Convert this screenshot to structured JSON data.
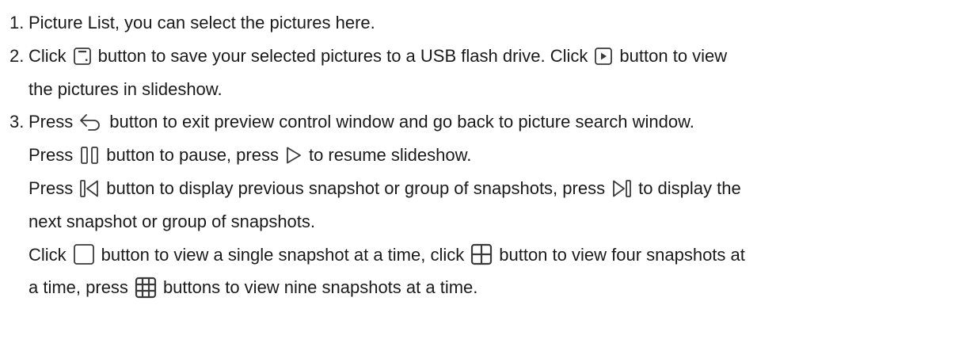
{
  "items": [
    {
      "number": "1.",
      "text": "Picture List, you can select the pictures here."
    },
    {
      "number": "2.",
      "lines": [
        {
          "a": "Click",
          "b": "button to save your selected pictures to a USB flash drive. Click",
          "c": "button to view"
        },
        {
          "a": "the pictures in slideshow."
        }
      ]
    },
    {
      "number": "3.",
      "lines": [
        {
          "a": "Press",
          "b": "button to exit preview control window and go back to picture search window."
        },
        {
          "a": "Press",
          "b": "button to pause, press",
          "c": "to resume slideshow."
        },
        {
          "a": "Press",
          "b": "button to display previous snapshot or group of snapshots, press",
          "c": "to display the"
        },
        {
          "a": "next snapshot or group of snapshots."
        },
        {
          "a": "Click",
          "b": "button to view a single snapshot at a time, click",
          "c": "button to view four snapshots at"
        },
        {
          "a": "a time, press",
          "b": "buttons to view nine snapshots at a time."
        }
      ]
    }
  ],
  "icons": {
    "save": "save-to-usb-icon",
    "play_box": "slideshow-play-icon",
    "back": "back-arrow-icon",
    "pause": "pause-icon",
    "resume": "resume-play-icon",
    "previous": "previous-snapshot-icon",
    "next": "next-snapshot-icon",
    "single": "single-view-icon",
    "four": "four-grid-view-icon",
    "nine": "nine-grid-view-icon"
  },
  "colors": {
    "text": "#1a1a1a",
    "icon": "#3a3a3a"
  }
}
